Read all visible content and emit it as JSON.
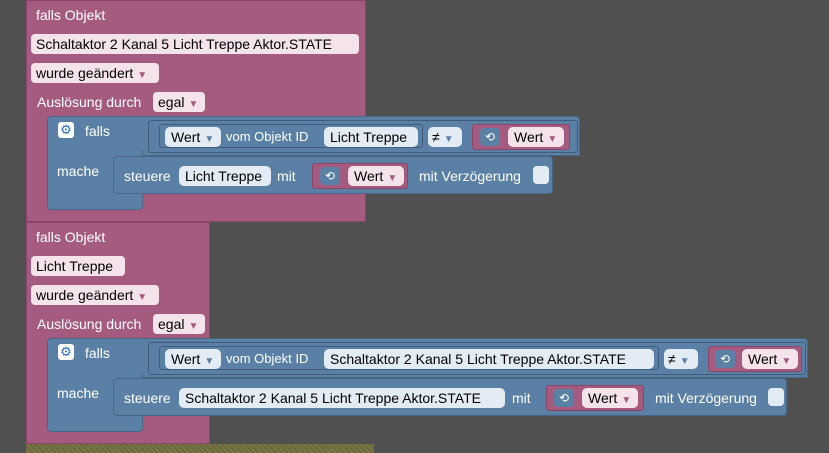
{
  "block1": {
    "header": "falls Objekt",
    "object": "Schaltaktor 2 Kanal 5 Licht Treppe Aktor.STATE",
    "trigger": "wurde geändert",
    "trigger_label": "Auslösung durch",
    "trigger_value": "egal",
    "if_label": "falls",
    "do_label": "mache",
    "value_dropdown": "Wert",
    "from_object_label": "vom Objekt ID",
    "from_object_value": "Licht Treppe",
    "operator": "≠",
    "compare_value": "Wert",
    "control_label": "steuere",
    "control_target": "Licht Treppe",
    "with_label": "mit",
    "with_value": "Wert",
    "delay_label": "mit Verzögerung"
  },
  "block2": {
    "header": "falls Objekt",
    "object": "Licht Treppe",
    "trigger": "wurde geändert",
    "trigger_label": "Auslösung durch",
    "trigger_value": "egal",
    "if_label": "falls",
    "do_label": "mache",
    "value_dropdown": "Wert",
    "from_object_label": "vom Objekt ID",
    "from_object_value": "Schaltaktor 2 Kanal 5 Licht Treppe Aktor.STATE",
    "operator": "≠",
    "compare_value": "Wert",
    "control_label": "steuere",
    "control_target": "Schaltaktor 2 Kanal 5 Licht Treppe Aktor.STATE",
    "with_label": "mit",
    "with_value": "Wert",
    "delay_label": "mit Verzögerung"
  },
  "colors": {
    "event_block": "#a55b80",
    "logic_block": "#5b80a5",
    "workspace": "#505050"
  },
  "icons": {
    "gear": "gear-icon",
    "loop": "loop-icon",
    "dropdown": "dropdown-arrow-icon"
  }
}
